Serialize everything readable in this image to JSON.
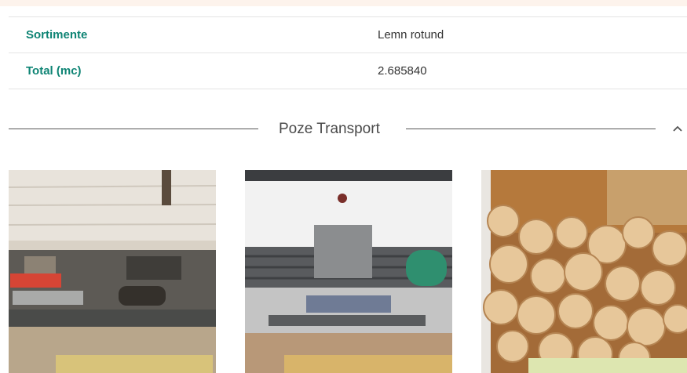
{
  "details": {
    "rows": [
      {
        "label": "Sortimente",
        "value": "Lemn rotund"
      },
      {
        "label": "Total (mc)",
        "value": "2.685840"
      }
    ]
  },
  "photos_section": {
    "title": "Poze Transport",
    "toggle_icon": "chevron-up-icon",
    "photos": [
      {
        "name": "truck-rear-photo"
      },
      {
        "name": "truck-front-photo"
      },
      {
        "name": "wood-logs-photo"
      }
    ]
  }
}
